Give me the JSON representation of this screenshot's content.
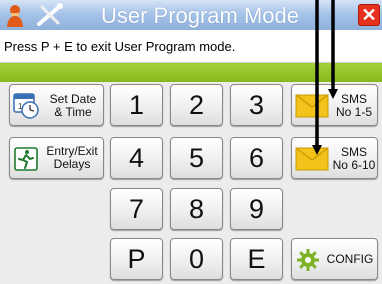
{
  "titlebar": {
    "title": "User Program Mode",
    "close_glyph": "✕"
  },
  "message": "Press P + E to exit User Program mode.",
  "keys": {
    "k1": "1",
    "k2": "2",
    "k3": "3",
    "k4": "4",
    "k5": "5",
    "k6": "6",
    "k7": "7",
    "k8": "8",
    "k9": "9",
    "kp": "P",
    "k0": "0",
    "ke": "E"
  },
  "side_buttons": {
    "set_date_line1": "Set Date",
    "set_date_line2": "& Time",
    "entry_exit_line1": "Entry/Exit",
    "entry_exit_line2": "Delays",
    "sms1_line1": "SMS",
    "sms1_line2": "No 1-5",
    "sms2_line1": "SMS",
    "sms2_line2": "No 6-10",
    "config": "CONFIG"
  },
  "icons": {
    "title": "user-tools-icon",
    "close": "close-icon",
    "calendar": "calendar-clock-icon",
    "running": "running-exit-icon",
    "envelope": "envelope-icon",
    "gear": "gear-icon"
  },
  "colors": {
    "accent_green": "#8fc02a",
    "title_blue": "#a7c3e8",
    "close_red": "#e8301e",
    "envelope_yellow": "#f4c31a"
  }
}
